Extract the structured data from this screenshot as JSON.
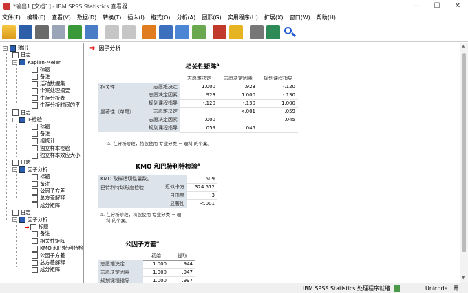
{
  "window": {
    "title": "*输出1 [文档1] - IBM SPSS Statistics 查看器",
    "min": "—",
    "max": "☐",
    "close": "✕"
  },
  "menu": [
    "文件(F)",
    "编辑(E)",
    "查看(V)",
    "数据(D)",
    "转换(T)",
    "插入(I)",
    "格式(O)",
    "分析(A)",
    "图形(G)",
    "实用程序(U)",
    "扩展(X)",
    "窗口(W)",
    "帮助(H)"
  ],
  "toolbar_icons": [
    "open-icon",
    "save-icon",
    "print-icon",
    "print-preview-icon",
    "export-icon",
    "recall-dialog-icon",
    "undo-icon",
    "redo-icon",
    "goto-data-icon",
    "goto-case-icon",
    "goto-variable-icon",
    "variables-icon",
    "create-title-icon",
    "insert-text-icon",
    "hide-icon",
    "show-icon",
    "search-icon"
  ],
  "tree": [
    {
      "label": "输出",
      "level": 0,
      "pm": "−",
      "icon": "book"
    },
    {
      "label": "日志",
      "level": 1,
      "icon": "doc"
    },
    {
      "label": "Kaplan-Meier",
      "level": 1,
      "pm": "−",
      "icon": "book"
    },
    {
      "label": "标题",
      "level": 2,
      "icon": "doc"
    },
    {
      "label": "备注",
      "level": 2,
      "icon": "doc"
    },
    {
      "label": "活动数据集",
      "level": 2,
      "icon": "doc"
    },
    {
      "label": "个案处理摘要",
      "level": 2,
      "icon": "doc"
    },
    {
      "label": "生存分析表",
      "level": 2,
      "icon": "doc"
    },
    {
      "label": "生存分析时间的平",
      "level": 2,
      "icon": "doc"
    },
    {
      "label": "日志",
      "level": 1,
      "icon": "doc"
    },
    {
      "label": "T-检验",
      "level": 1,
      "pm": "−",
      "icon": "book"
    },
    {
      "label": "标题",
      "level": 2,
      "icon": "doc"
    },
    {
      "label": "备注",
      "level": 2,
      "icon": "doc"
    },
    {
      "label": "组统计",
      "level": 2,
      "icon": "doc"
    },
    {
      "label": "独立样本检验",
      "level": 2,
      "icon": "doc"
    },
    {
      "label": "独立样本效应大小",
      "level": 2,
      "icon": "doc"
    },
    {
      "label": "日志",
      "level": 1,
      "icon": "doc"
    },
    {
      "label": "因子分析",
      "level": 1,
      "pm": "−",
      "icon": "book"
    },
    {
      "label": "标题",
      "level": 2,
      "icon": "doc"
    },
    {
      "label": "备注",
      "level": 2,
      "icon": "doc"
    },
    {
      "label": "公因子方差",
      "level": 2,
      "icon": "doc"
    },
    {
      "label": "总方差解释",
      "level": 2,
      "icon": "doc"
    },
    {
      "label": "成分矩阵",
      "level": 2,
      "icon": "doc"
    },
    {
      "label": "日志",
      "level": 1,
      "icon": "doc"
    },
    {
      "label": "因子分析",
      "level": 1,
      "pm": "−",
      "icon": "book"
    },
    {
      "label": "标题",
      "level": 2,
      "icon": "doc",
      "current": true
    },
    {
      "label": "备注",
      "level": 2,
      "icon": "doc"
    },
    {
      "label": "相关性矩阵",
      "level": 2,
      "icon": "doc"
    },
    {
      "label": "KMO 和巴特利特检",
      "level": 2,
      "icon": "doc"
    },
    {
      "label": "公因子方差",
      "level": 2,
      "icon": "doc"
    },
    {
      "label": "总方差解释",
      "level": 2,
      "icon": "doc"
    },
    {
      "label": "成分矩阵",
      "level": 2,
      "icon": "doc"
    }
  ],
  "content": {
    "section_title": "因子分析",
    "corr": {
      "title": "相关性矩阵",
      "sup": "a",
      "cols": [
        "志愿难决定",
        "志愿决定因素",
        "规划课程指导"
      ],
      "group1": "相关性",
      "group2": "显著性（单尾）",
      "rows": [
        {
          "label": "志愿难决定",
          "v": [
            "1.000",
            ".923",
            "-.120"
          ]
        },
        {
          "label": "志愿决定因素",
          "v": [
            ".923",
            "1.000",
            "-.130"
          ]
        },
        {
          "label": "规划课程指导",
          "v": [
            "-.120",
            "-.130",
            "1.000"
          ]
        },
        {
          "label": "志愿难决定",
          "v": [
            "",
            "<.001",
            ".059"
          ]
        },
        {
          "label": "志愿决定因素",
          "v": [
            ".000",
            "",
            ".045"
          ]
        },
        {
          "label": "规划课程指导",
          "v": [
            ".059",
            ".045",
            ""
          ]
        }
      ],
      "note": "a. 在分析阶段，将仅使用 专业分类 = 理科 的个案。"
    },
    "kmo": {
      "title": "KMO 和巴特利特检验",
      "sup": "a",
      "kmo_label": "KMO 取样适切性量数。",
      "kmo_val": ".509",
      "bart_label": "巴特利特球形度检验",
      "rows": [
        {
          "label": "近似卡方",
          "v": "324.512"
        },
        {
          "label": "自由度",
          "v": "3"
        },
        {
          "label": "显著性",
          "v": "<.001"
        }
      ],
      "note1": "a. 在分析阶段，将仅使用 专业分类 = 理",
      "note2": "科 的个案。"
    },
    "comm": {
      "title": "公因子方差",
      "sup": "a",
      "cols": [
        "初始",
        "提取"
      ],
      "rows": [
        {
          "label": "志愿难决定",
          "v": [
            "1.000",
            ".944"
          ]
        },
        {
          "label": "志愿决定因素",
          "v": [
            "1.000",
            ".947"
          ]
        },
        {
          "label": "规划课程指导",
          "v": [
            "1.000",
            ".997"
          ]
        }
      ]
    }
  },
  "status": {
    "text": "IBM SPSS Statistics 处理程序就绪",
    "unicode": "Unicode：开"
  }
}
